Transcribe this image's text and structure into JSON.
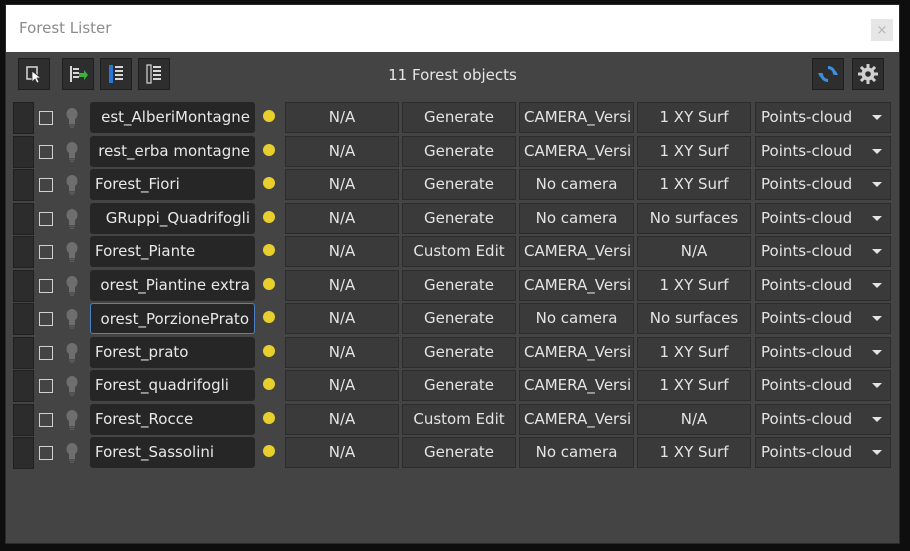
{
  "window": {
    "title": "Forest Lister",
    "close_label": "×"
  },
  "toolbar": {
    "count_text": "11 Forest objects",
    "buttons": [
      "select-icon",
      "add-object-icon",
      "columns-icon",
      "columns-alt-icon"
    ],
    "right_buttons": [
      "refresh-icon",
      "settings-icon"
    ]
  },
  "rows": [
    {
      "name": "est_AlberiMontagne",
      "value": "N/A",
      "mode": "Generate",
      "camera": "CAMERA_Versi",
      "surface": "1 XY Surf",
      "display": "Points-cloud"
    },
    {
      "name": "rest_erba montagne",
      "value": "N/A",
      "mode": "Generate",
      "camera": "CAMERA_Versi",
      "surface": "1 XY Surf",
      "display": "Points-cloud"
    },
    {
      "name": "Forest_Fiori",
      "value": "N/A",
      "mode": "Generate",
      "camera": "No camera",
      "surface": "1 XY Surf",
      "display": "Points-cloud"
    },
    {
      "name": "GRuppi_Quadrifogli",
      "value": "N/A",
      "mode": "Generate",
      "camera": "No camera",
      "surface": "No surfaces",
      "display": "Points-cloud"
    },
    {
      "name": "Forest_Piante",
      "value": "N/A",
      "mode": "Custom Edit",
      "camera": "CAMERA_Versi",
      "surface": "N/A",
      "display": "Points-cloud"
    },
    {
      "name": "orest_Piantine extra",
      "value": "N/A",
      "mode": "Generate",
      "camera": "CAMERA_Versi",
      "surface": "1 XY Surf",
      "display": "Points-cloud"
    },
    {
      "name": "orest_PorzionePrato",
      "value": "N/A",
      "mode": "Generate",
      "camera": "No camera",
      "surface": "No surfaces",
      "display": "Points-cloud"
    },
    {
      "name": "Forest_prato",
      "value": "N/A",
      "mode": "Generate",
      "camera": "CAMERA_Versi",
      "surface": "1 XY Surf",
      "display": "Points-cloud"
    },
    {
      "name": "Forest_quadrifogli",
      "value": "N/A",
      "mode": "Generate",
      "camera": "CAMERA_Versi",
      "surface": "1 XY Surf",
      "display": "Points-cloud"
    },
    {
      "name": "Forest_Rocce",
      "value": "N/A",
      "mode": "Custom Edit",
      "camera": "CAMERA_Versi",
      "surface": "N/A",
      "display": "Points-cloud"
    },
    {
      "name": "Forest_Sassolini",
      "value": "N/A",
      "mode": "Generate",
      "camera": "No camera",
      "surface": "1 XY Surf",
      "display": "Points-cloud"
    }
  ],
  "colors": {
    "window_bg": "#444444",
    "status_dot": "#e9cf2e",
    "active_outline": "#4a82c8"
  }
}
